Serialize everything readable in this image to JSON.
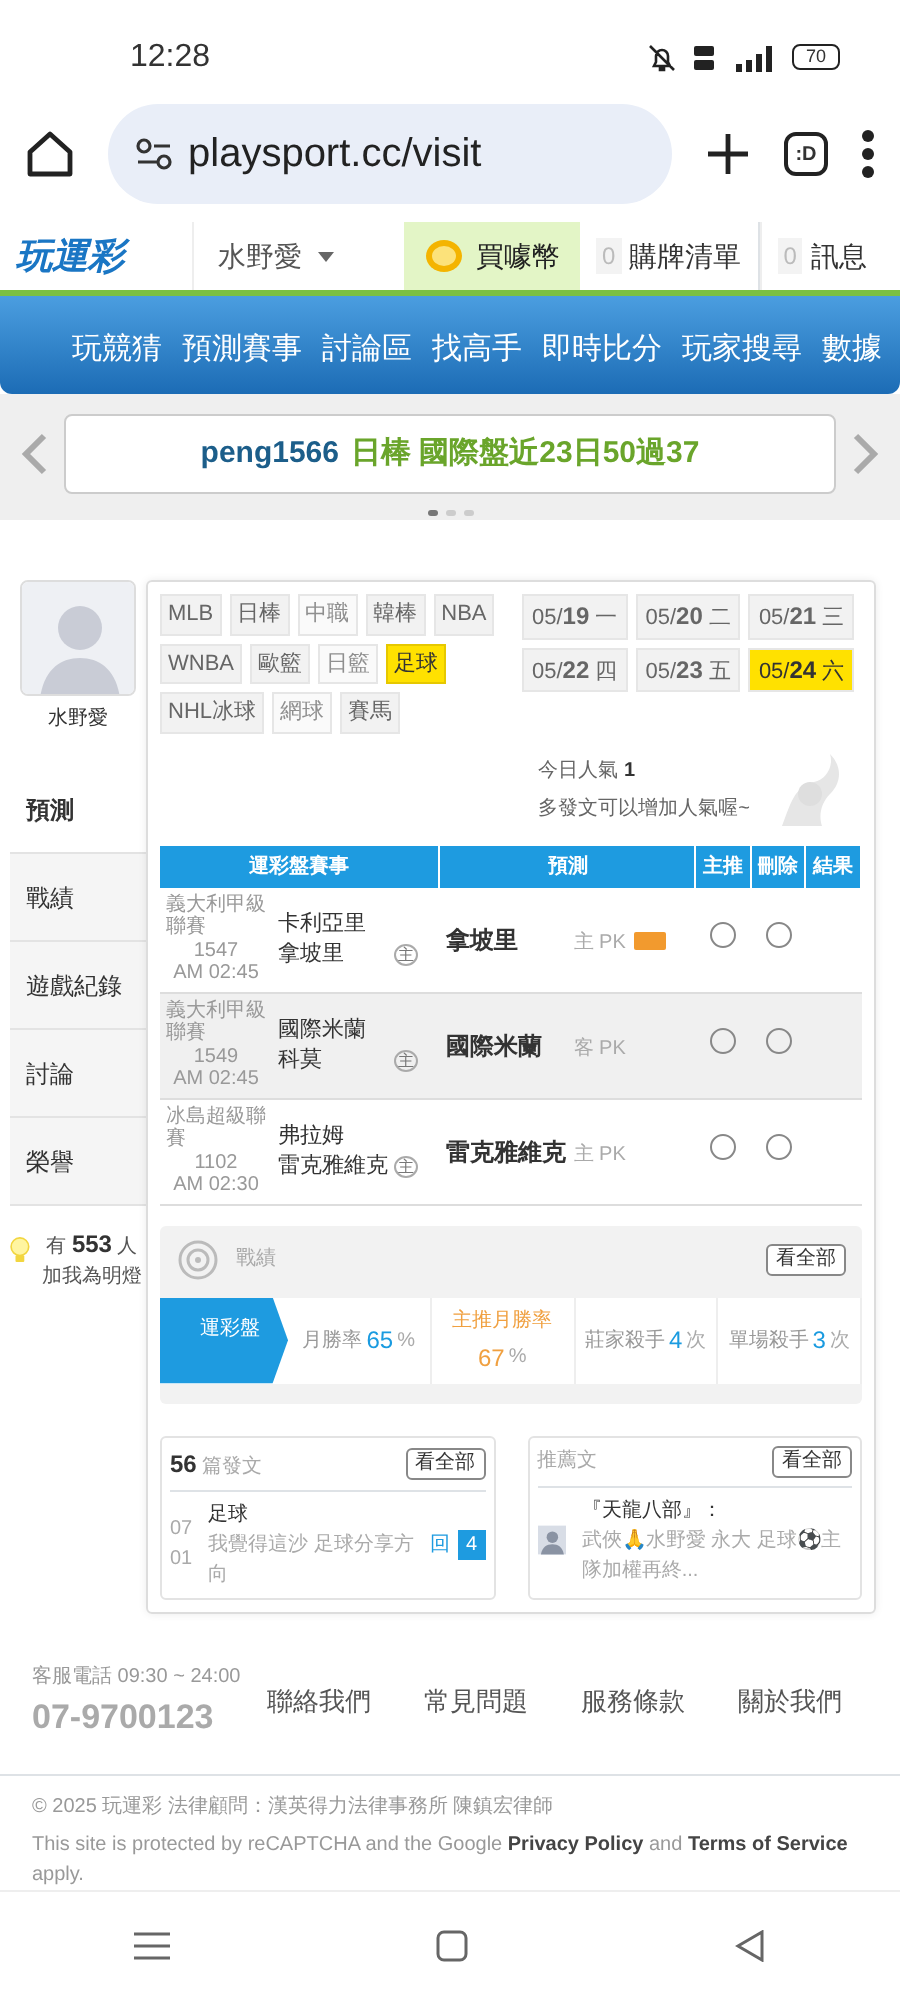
{
  "status_bar": {
    "time": "12:28",
    "battery": "70"
  },
  "browser": {
    "url": "playsport.cc/visit",
    "tab_label": ":D"
  },
  "site_header": {
    "logo": "玩運彩",
    "user": "水野愛",
    "buy_coins": "買噱幣",
    "cart": {
      "count": "0",
      "label": "購牌清單"
    },
    "messages": {
      "count": "0",
      "label": "訊息"
    }
  },
  "nav": [
    "玩競猜",
    "預測賽事",
    "討論區",
    "找高手",
    "即時比分",
    "玩家搜尋",
    "數據"
  ],
  "ticker": {
    "user": "peng1566",
    "text": "日棒 國際盤近23日50過37",
    "pages": [
      {
        "selected": true
      },
      {
        "selected": false
      },
      {
        "selected": false
      }
    ]
  },
  "profile": {
    "name": "水野愛"
  },
  "side_menu": [
    {
      "label": "預測",
      "selected": true
    },
    {
      "label": "戰績",
      "selected": false
    },
    {
      "label": "遊戲紀錄",
      "selected": false
    },
    {
      "label": "討論",
      "selected": false
    },
    {
      "label": "榮譽",
      "selected": false
    }
  ],
  "fans": {
    "prefix": "有",
    "count": "553",
    "suffix": "人",
    "caption": "加我為明燈"
  },
  "sports": [
    {
      "label": "MLB",
      "selected": false,
      "disabled": false
    },
    {
      "label": "日棒",
      "selected": false,
      "disabled": false
    },
    {
      "label": "中職",
      "selected": false,
      "disabled": true
    },
    {
      "label": "韓棒",
      "selected": false,
      "disabled": false
    },
    {
      "label": "NBA",
      "selected": false,
      "disabled": false
    },
    {
      "label": "WNBA",
      "selected": false,
      "disabled": false
    },
    {
      "label": "歐籃",
      "selected": false,
      "disabled": false
    },
    {
      "label": "日籃",
      "selected": false,
      "disabled": true
    },
    {
      "label": "足球",
      "selected": true,
      "disabled": false
    },
    {
      "label": "NHL冰球",
      "selected": false,
      "disabled": false
    },
    {
      "label": "網球",
      "selected": false,
      "disabled": true
    },
    {
      "label": "賽馬",
      "selected": false,
      "disabled": false
    }
  ],
  "dates": [
    {
      "month": "05/",
      "day": "19",
      "weekday": "一",
      "selected": false
    },
    {
      "month": "05/",
      "day": "20",
      "weekday": "二",
      "selected": false
    },
    {
      "month": "05/",
      "day": "21",
      "weekday": "三",
      "selected": false
    },
    {
      "month": "05/",
      "day": "22",
      "weekday": "四",
      "selected": false
    },
    {
      "month": "05/",
      "day": "23",
      "weekday": "五",
      "selected": false
    },
    {
      "month": "05/",
      "day": "24",
      "weekday": "六",
      "selected": true
    }
  ],
  "popularity": {
    "label": "今日人氣",
    "value": "1",
    "hint": "多發文可以增加人氣喔~"
  },
  "predictions": {
    "columns": [
      "運彩盤賽事",
      "預測",
      "主推",
      "刪除",
      "結果"
    ],
    "rows": [
      {
        "league": "義大利甲級聯賽",
        "game_no": "1547",
        "time": "AM 02:45",
        "away": "卡利亞里",
        "home": "拿坡里",
        "home_mark": "主",
        "pick": "拿坡里",
        "side": "主",
        "line": "PK",
        "tag": true,
        "main_pick": false,
        "delete": false
      },
      {
        "league": "義大利甲級聯賽",
        "game_no": "1549",
        "time": "AM 02:45",
        "away": "國際米蘭",
        "home": "科莫",
        "home_mark": "主",
        "pick": "國際米蘭",
        "side": "客",
        "line": "PK",
        "tag": false,
        "main_pick": false,
        "delete": false
      },
      {
        "league": "冰島超級聯賽",
        "game_no": "1102",
        "time": "AM 02:30",
        "away": "弗拉姆",
        "home": "雷克雅維克",
        "home_mark": "主",
        "pick": "雷克雅維克",
        "side": "主",
        "line": "PK",
        "tag": false,
        "main_pick": false,
        "delete": false
      }
    ]
  },
  "record": {
    "title": "戰績",
    "view_all": "看全部",
    "tab": "運彩盤",
    "stats": [
      {
        "label": "月勝率",
        "value": "65",
        "unit": "%",
        "color": "#1a9be0"
      },
      {
        "label": "主推月勝率",
        "value": "67",
        "unit": "%",
        "color": "#f0a040"
      },
      {
        "label": "莊家殺手",
        "value": "4",
        "unit": "次",
        "color": "#1a9be0"
      },
      {
        "label": "單場殺手",
        "value": "3",
        "unit": "次",
        "color": "#1a9be0"
      }
    ]
  },
  "posts": {
    "count": "56",
    "label": "篇發文",
    "view_all": "看全部",
    "items": [
      {
        "month": "07",
        "day": "01",
        "category": "足球",
        "title": "我覺得這沙 足球分享方向",
        "reply_label": "回",
        "replies": "4"
      }
    ]
  },
  "recommended": {
    "title": "推薦文",
    "view_all": "看全部",
    "items": [
      {
        "title": "『天龍八部』：",
        "excerpt": "武俠🙏水野愛 永大 足球⚽主隊加權再終..."
      }
    ]
  },
  "footer": {
    "hotline_label": "客服電話 09:30 ~ 24:00",
    "hotline": "07-9700123",
    "links": [
      "聯絡我們",
      "常見問題",
      "服務條款",
      "關於我們"
    ],
    "copyright": "© 2025 玩運彩 法律顧問：漢英得力法律事務所 陳鎮宏律師",
    "recaptcha": {
      "before": "This site is protected by reCAPTCHA and the Google",
      "privacy": "Privacy Policy",
      "middle": "and",
      "terms": "Terms of Service",
      "after": "apply."
    }
  }
}
